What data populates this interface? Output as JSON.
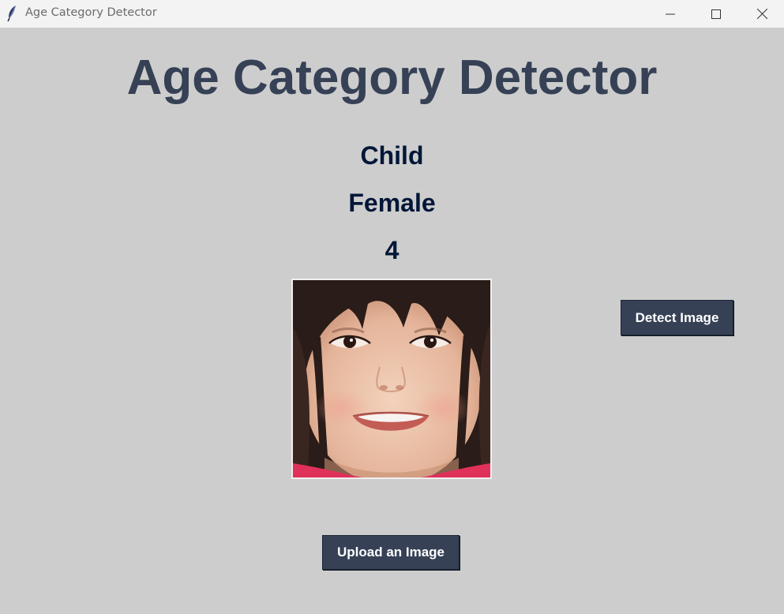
{
  "window": {
    "title": "Age Category Detector",
    "controls": {
      "minimize_icon": "minimize-icon",
      "maximize_icon": "maximize-icon",
      "close_icon": "close-icon"
    }
  },
  "app": {
    "heading": "Age Category Detector",
    "result": {
      "category": "Child",
      "gender": "Female",
      "age": "4"
    },
    "detect_button_label": "Detect Image",
    "upload_button_label": "Upload an Image"
  },
  "colors": {
    "background": "#cdcdcd",
    "heading": "#364156",
    "result_text": "#011638",
    "button_bg": "#364156",
    "button_text": "#ffffff"
  }
}
